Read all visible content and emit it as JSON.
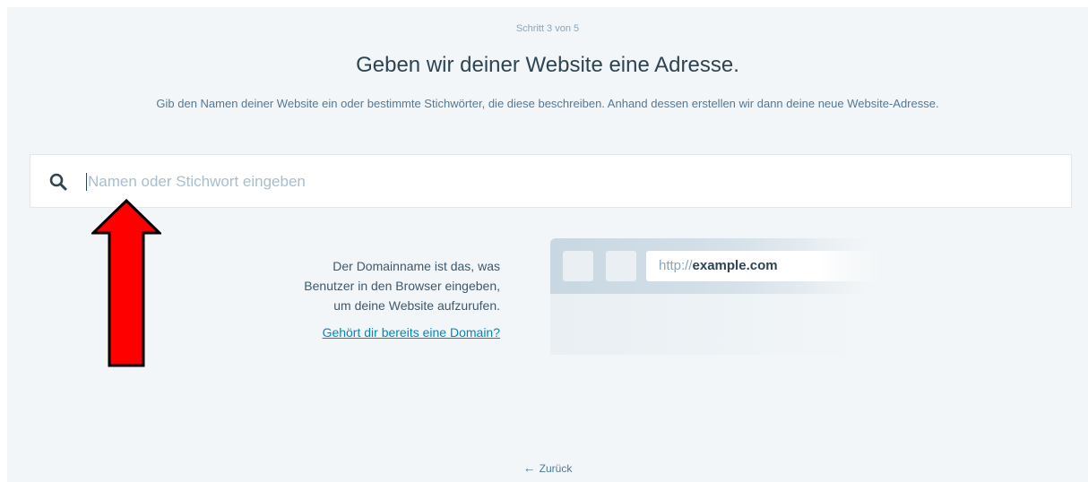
{
  "header": {
    "step": "Schritt 3 von 5",
    "title": "Geben wir deiner Website eine Adresse.",
    "subtitle": "Gib den Namen deiner Website ein oder bestimmte Stichwörter, die diese beschreiben. Anhand dessen erstellen wir dann deine neue Website-Adresse."
  },
  "search": {
    "placeholder": "Namen oder Stichwort eingeben",
    "value": "",
    "icon": "search-icon"
  },
  "info": {
    "line1": "Der Domainname ist das, was",
    "line2": "Benutzer in den Browser eingeben,",
    "line3": "um deine Website aufzurufen.",
    "link": "Gehört dir bereits eine Domain?"
  },
  "browser_illustration": {
    "url_protocol": "http://",
    "url_domain": "example.com"
  },
  "footer": {
    "back_arrow": "←",
    "back_label": "Zurück"
  },
  "colors": {
    "background": "#f3f6f8",
    "title": "#2e4453",
    "link": "#0087be",
    "annotation_arrow": "#ff0000"
  }
}
